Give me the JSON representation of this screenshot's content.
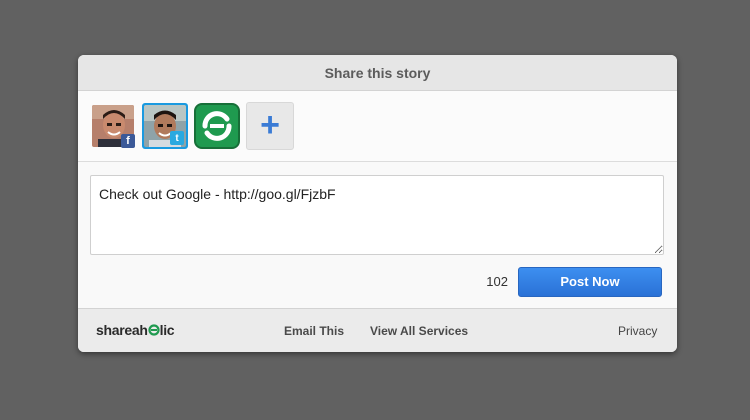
{
  "dialog": {
    "title": "Share this story"
  },
  "accounts": [
    {
      "service": "facebook",
      "badge": "f",
      "selected": false
    },
    {
      "service": "twitter",
      "badge": "t",
      "selected": true
    },
    {
      "service": "shareaholic",
      "selected": false
    },
    {
      "service": "add-account",
      "icon": "plus-icon",
      "label": "+"
    }
  ],
  "composer": {
    "message": "Check out Google - http://goo.gl/FjzbF",
    "char_count": "102",
    "post_label": "Post Now"
  },
  "footer": {
    "logo_text": "shareahlic",
    "logo_prefix": "shareah",
    "logo_suffix": "lic",
    "email_label": "Email This",
    "services_label": "View All Services",
    "privacy_label": "Privacy"
  },
  "colors": {
    "accent": "#2f7ddf",
    "shareaholic_green": "#1f9a4f",
    "facebook": "#3b5998",
    "twitter": "#2aa9e0"
  }
}
